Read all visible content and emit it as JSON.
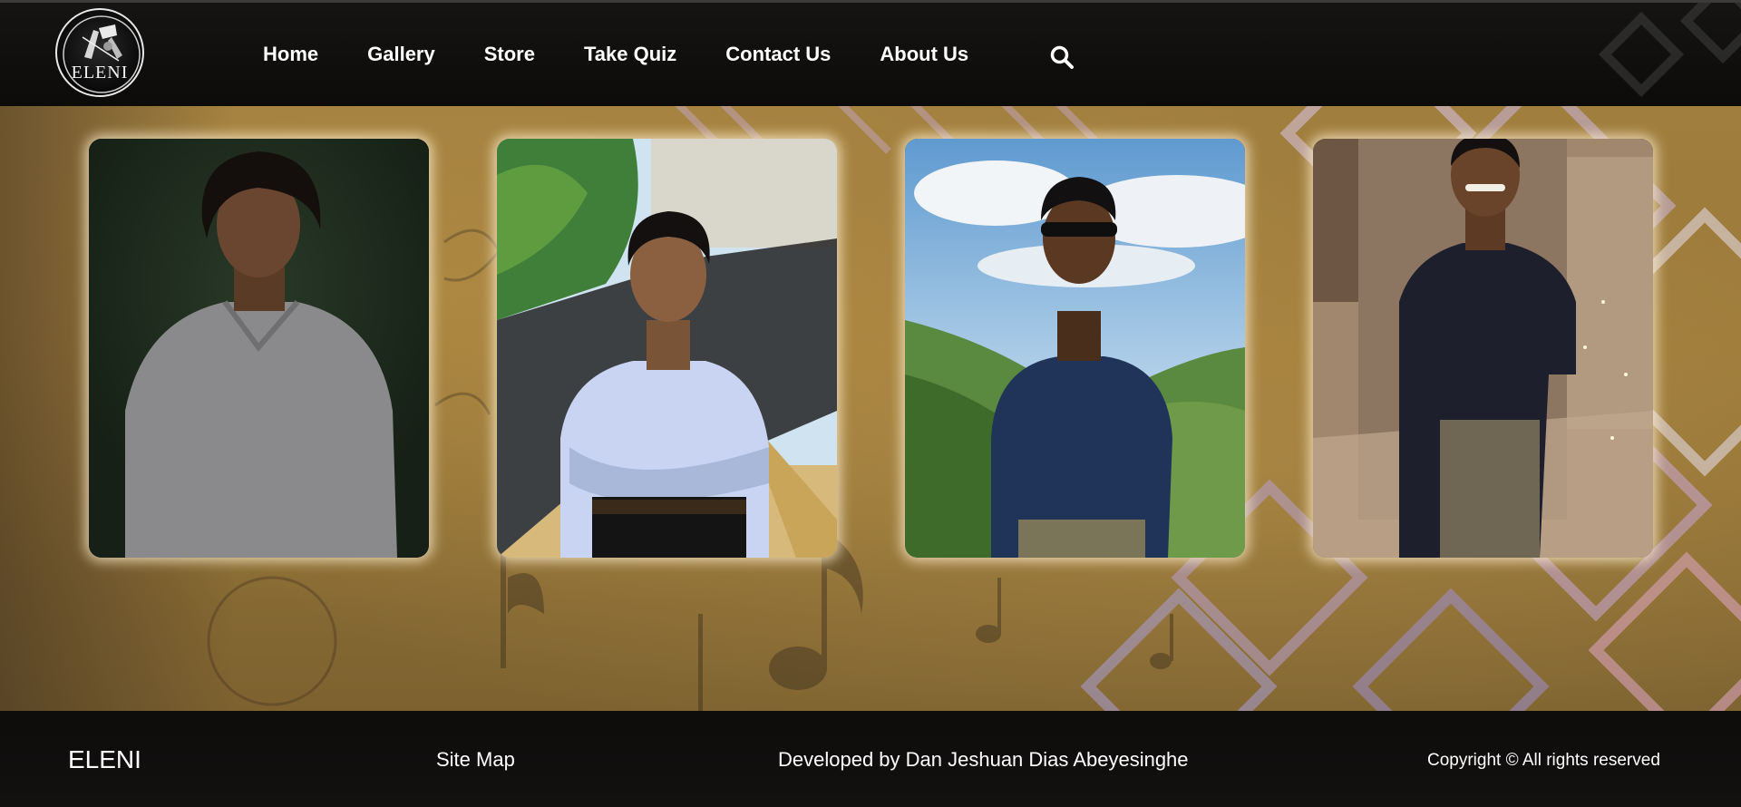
{
  "header": {
    "logo_text": "ELENI",
    "nav": [
      "Home",
      "Gallery",
      "Store",
      "Take Quiz",
      "Contact Us",
      "About Us"
    ],
    "search_icon": "search-icon"
  },
  "gallery": {
    "photos": [
      {
        "name": "photo-1",
        "shirt_color": "#8a8a8c",
        "background": "#1c2a1b"
      },
      {
        "name": "photo-2",
        "shirt_color": "#c8d4f2",
        "background": "#3f7f3a"
      },
      {
        "name": "photo-3",
        "shirt_color": "#1f3458",
        "background": "#7fb3e0"
      },
      {
        "name": "photo-4",
        "shirt_color": "#1d1f2c",
        "background": "#8a7662"
      }
    ]
  },
  "footer": {
    "brand": "ELENI",
    "site_map": "Site Map",
    "developer": "Developed by Dan Jeshuan Dias Abeyesinghe",
    "copyright": "Copyright © All rights reserved"
  },
  "colors": {
    "header_bg": "#0c0b0a",
    "gold": "#a07e3e",
    "nav_text": "#ffffff"
  }
}
